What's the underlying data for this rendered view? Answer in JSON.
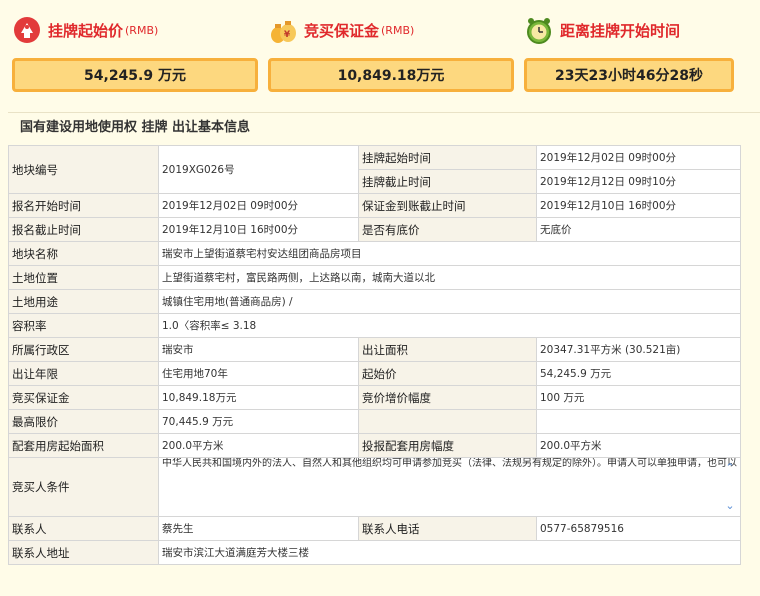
{
  "header": {
    "start_price": {
      "label": "挂牌起始价",
      "unit": "(RMB)",
      "value": "54,245.9 万元"
    },
    "deposit": {
      "label": "竞买保证金",
      "unit": "(RMB)",
      "value": "10,849.18万元"
    },
    "countdown": {
      "label": "距离挂牌开始时间",
      "value": "23天23小时46分28秒"
    }
  },
  "section_title": "国有建设用地使用权 挂牌 出让基本信息",
  "table": {
    "parcel_no_label": "地块编号",
    "parcel_no": "2019XG026号",
    "list_start_label": "挂牌起始时间",
    "list_start": "2019年12月02日 09时00分",
    "list_end_label": "挂牌截止时间",
    "list_end": "2019年12月12日 09时10分",
    "apply_start_label": "报名开始时间",
    "apply_start": "2019年12月02日 09时00分",
    "deposit_deadline_label": "保证金到账截止时间",
    "deposit_deadline": "2019年12月10日 16时00分",
    "apply_end_label": "报名截止时间",
    "apply_end": "2019年12月10日 16时00分",
    "reserve_label": "是否有底价",
    "reserve": "无底价",
    "name_label": "地块名称",
    "name": "瑞安市上望街道蔡宅村安达组团商品房项目",
    "location_label": "土地位置",
    "location": "上望街道蔡宅村，富民路两侧，上达路以南，城南大道以北",
    "use_label": "土地用途",
    "use": "城镇住宅用地(普通商品房) /",
    "far_label": "容积率",
    "far": "1.0〈容积率≤ 3.18",
    "district_label": "所属行政区",
    "district": "瑞安市",
    "area_label": "出让面积",
    "area": "20347.31平方米 (30.521亩)",
    "term_label": "出让年限",
    "term": "住宅用地70年",
    "start_price_label": "起始价",
    "start_price": "54,245.9 万元",
    "deposit_label": "竞买保证金",
    "deposit": "10,849.18万元",
    "increment_label": "竞价增价幅度",
    "increment": "100 万元",
    "max_price_label": "最高限价",
    "max_price": "70,445.9 万元",
    "support_area_label": "配套用房起始面积",
    "support_area": "200.0平方米",
    "support_increment_label": "投报配套用房幅度",
    "support_increment": "200.0平方米",
    "bidder_cond_label": "竞买人条件",
    "bidder_cond": "中华人民共和国境内外的法人、自然人和其他组织均可申请参加竞买（法律、法规另有规定的除外）。申请人可以单独申请，也可以联合申请，联合申请的应当签订联合竞买协议书。竞得人为自然人或企业登记注册地不在瑞安的，须在成交后6个月内，在瑞安市内登记成立具有相应开发资格的、由竞得人全额出资的独立法人新公司（如联合竞买的，新公司的出资比例构成与竞得人在联合竞买协议书中约定的出资比例构成必须一致），并进行土地开发利用建设。新公司的出资比例构成与竞得人在联合竞买协议书中约定的出资比例构成必须一致，并按本方有关行政管理部门的监督管理，独立",
    "contact_label": "联系人",
    "contact": "蔡先生",
    "phone_label": "联系人电话",
    "phone": "0577-65879516",
    "address_label": "联系人地址",
    "address": "瑞安市滨江大道满庭芳大楼三楼"
  },
  "colors": {
    "accent_red": "#e0292c",
    "value_box": "#fdd87f",
    "value_border": "#f7b03c",
    "label_bg": "#f7f3e8"
  }
}
